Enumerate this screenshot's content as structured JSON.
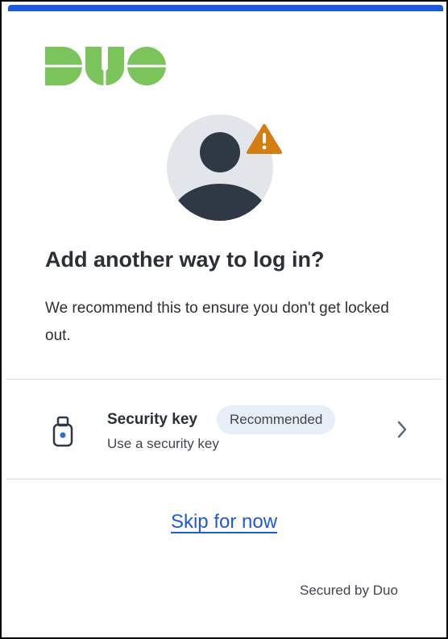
{
  "brand": {
    "logo_text": "DUO",
    "accent_color": "#1f5bd6",
    "logo_color": "#7bc35b",
    "warning_color": "#d47e12"
  },
  "icons": {
    "avatar": "user-avatar-icon",
    "warning": "warning-icon",
    "security_key": "security-key-icon",
    "chevron": "chevron-right-icon"
  },
  "main": {
    "title": "Add another way to log in?",
    "description": "We recommend this to ensure you don't get locked out."
  },
  "option": {
    "title": "Security key",
    "badge": "Recommended",
    "subtitle": "Use a security key"
  },
  "skip_link": "Skip for now",
  "footer": "Secured by Duo"
}
